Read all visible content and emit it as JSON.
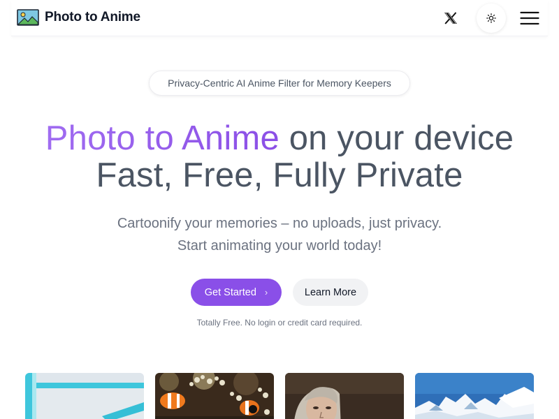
{
  "header": {
    "app_name": "Photo to Anime",
    "logo_icon": "image-landscape-icon",
    "x_icon": "x-logo-icon",
    "theme_icon": "sun-icon",
    "menu_icon": "hamburger-menu-icon"
  },
  "hero": {
    "badge": "Privacy-Centric AI Anime Filter for Memory Keepers",
    "title_highlight": "Photo to Anime",
    "title_rest": " on your device",
    "title_line2": "Fast, Free, Fully Private",
    "subtitle_line1": "Cartoonify your memories – no uploads, just privacy.",
    "subtitle_line2": "Start animating your world today!",
    "primary_button": "Get Started",
    "secondary_button": "Learn More",
    "note": "Totally Free. No login or credit card required."
  },
  "colors": {
    "accent": "#8a4fe8",
    "title_gradient_start": "#a06cf1",
    "title_text": "#4b5563",
    "secondary_button_bg": "#f1f2f4"
  },
  "gallery": [
    {
      "name": "anime-sample-1"
    },
    {
      "name": "anime-sample-clownfish"
    },
    {
      "name": "anime-sample-portrait"
    },
    {
      "name": "anime-sample-mountains"
    }
  ]
}
